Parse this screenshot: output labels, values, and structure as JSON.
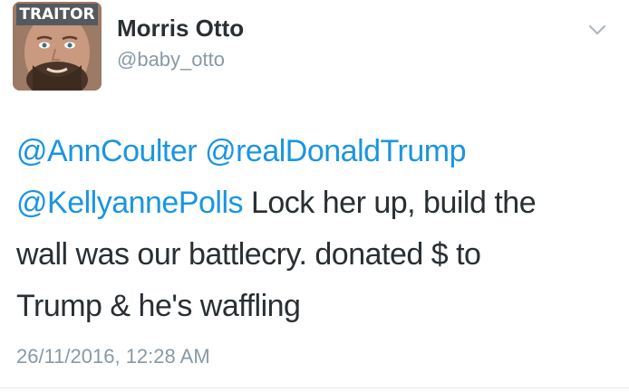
{
  "author": {
    "avatar_badge": "TRAITOR",
    "display_name": "Morris Otto",
    "handle": "@baby_otto"
  },
  "tweet": {
    "lines": [
      [
        {
          "text": "@AnnCoulter",
          "type": "mention"
        },
        {
          "text": " ",
          "type": "text"
        },
        {
          "text": "@realDonaldTrump",
          "type": "mention"
        }
      ],
      [
        {
          "text": "@KellyannePolls",
          "type": "mention"
        },
        {
          "text": " Lock her up, build the",
          "type": "text"
        }
      ],
      [
        {
          "text": "wall was our battlecry. donated $ to",
          "type": "text"
        }
      ],
      [
        {
          "text": "Trump & he's waffling",
          "type": "text"
        }
      ]
    ],
    "timestamp": "26/11/2016, 12:28 AM"
  },
  "icons": {
    "caret": "chevron-down-icon"
  },
  "colors": {
    "mention": "#1b95e0",
    "text": "#292f33",
    "secondary": "#8899a6",
    "divider": "#e1e8ed"
  }
}
